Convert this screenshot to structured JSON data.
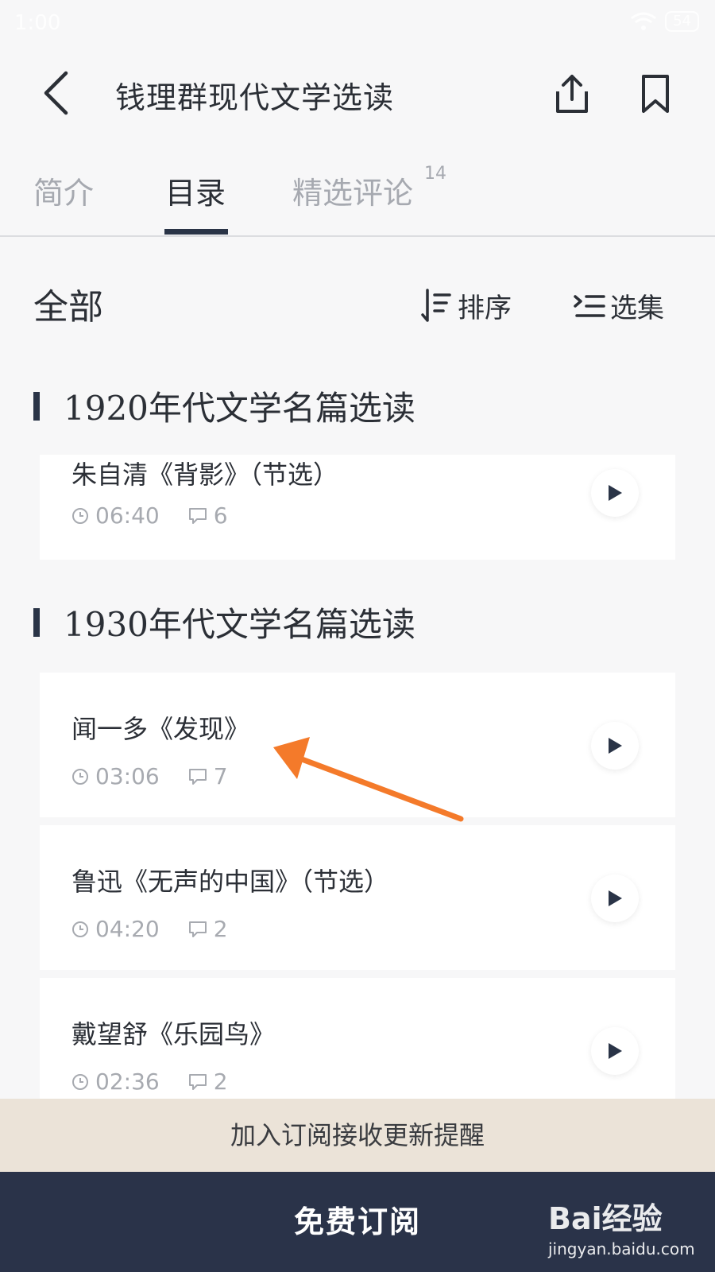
{
  "status_bar": {
    "time": "1:00",
    "battery": "54"
  },
  "header": {
    "title": "钱理群现代文学选读"
  },
  "tabs": [
    {
      "label": "简介",
      "active": false
    },
    {
      "label": "目录",
      "active": true
    },
    {
      "label": "精选评论",
      "badge": "14",
      "active": false
    }
  ],
  "section": {
    "all_label": "全部",
    "sort_label": "排序",
    "select_label": "选集"
  },
  "groups": [
    {
      "title": "1920年代文学名篇选读",
      "items": [
        {
          "title": "朱自清《背影》（节选）",
          "duration": "06:40",
          "comments": "6"
        }
      ]
    },
    {
      "title": "1930年代文学名篇选读",
      "items": [
        {
          "title": "闻一多《发现》",
          "duration": "03:06",
          "comments": "7"
        },
        {
          "title": "鲁迅《无声的中国》（节选）",
          "duration": "04:20",
          "comments": "2"
        },
        {
          "title": "戴望舒《乐园鸟》",
          "duration": "02:36",
          "comments": "2"
        }
      ]
    }
  ],
  "bottom": {
    "banner": "加入订阅接收更新提醒",
    "subscribe": "免费订阅"
  },
  "watermark": {
    "logo": "Bai经验",
    "url": "jingyan.baidu.com"
  },
  "colors": {
    "primary_dark": "#2a3349",
    "banner": "#ebe3d8",
    "annotation_arrow": "#f47a2a",
    "muted_text": "#a7aab0"
  }
}
